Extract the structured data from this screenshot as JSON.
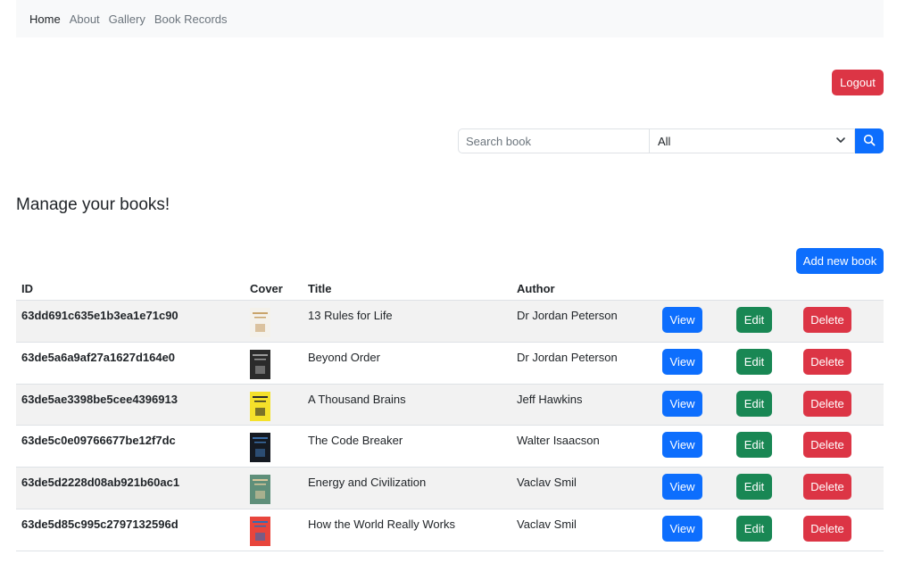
{
  "nav": {
    "items": [
      {
        "label": "Home"
      },
      {
        "label": "About"
      },
      {
        "label": "Gallery"
      },
      {
        "label": "Book Records"
      }
    ]
  },
  "header": {
    "logout_label": "Logout"
  },
  "search": {
    "placeholder": "Search book",
    "value": "",
    "filter_selected": "All",
    "button_icon": "search-icon"
  },
  "main": {
    "heading": "Manage your books!",
    "add_button_label": "Add new book"
  },
  "table": {
    "columns": [
      "ID",
      "Cover",
      "Title",
      "Author"
    ],
    "action_labels": {
      "view": "View",
      "edit": "Edit",
      "delete": "Delete"
    },
    "rows": [
      {
        "id": "63dd691c635e1b3ea1e71c90",
        "title": "13 Rules for Life",
        "author": "Dr Jordan Peterson",
        "cover": {
          "bg": "#f4f1ea",
          "fg": "#c9a46a"
        }
      },
      {
        "id": "63de5a6a9af27a1627d164e0",
        "title": "Beyond Order",
        "author": "Dr Jordan Peterson",
        "cover": {
          "bg": "#2b2b2b",
          "fg": "#9a9a9a"
        }
      },
      {
        "id": "63de5ae3398be5cee4396913",
        "title": "A Thousand Brains",
        "author": "Jeff Hawkins",
        "cover": {
          "bg": "#f5e12a",
          "fg": "#2a2a2a"
        }
      },
      {
        "id": "63de5c0e09766677be12f7dc",
        "title": "The Code Breaker",
        "author": "Walter Isaacson",
        "cover": {
          "bg": "#151a22",
          "fg": "#3a6ea8"
        }
      },
      {
        "id": "63de5d2228d08ab921b60ac1",
        "title": "Energy and Civilization",
        "author": "Vaclav Smil",
        "cover": {
          "bg": "#5f8f7a",
          "fg": "#d8c79b"
        }
      },
      {
        "id": "63de5d85c995c2797132596d",
        "title": "How the World Really Works",
        "author": "Vaclav Smil",
        "cover": {
          "bg": "#e8453c",
          "fg": "#2f6db5"
        }
      }
    ]
  },
  "colors": {
    "primary": "#0d6efd",
    "success": "#198754",
    "danger": "#dc3545",
    "navbar_bg": "#f8f9fa",
    "row_stripe": "#f2f2f2"
  }
}
